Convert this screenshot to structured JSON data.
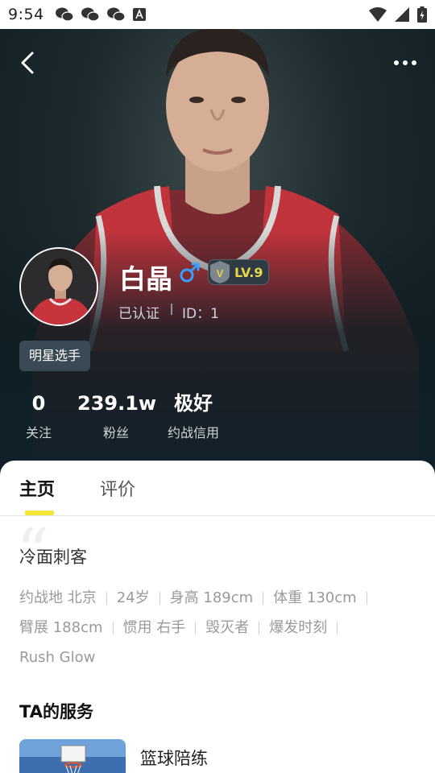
{
  "status_bar": {
    "time": "9:54",
    "left_icons": [
      "wechat-icon",
      "wechat-icon",
      "wechat-icon",
      "a-icon"
    ],
    "right_icons": [
      "wifi-icon",
      "signal-icon",
      "battery-icon"
    ]
  },
  "header": {
    "back_icon": "chevron-left-icon",
    "more_icon": "more-dots-icon"
  },
  "profile": {
    "name": "白晶",
    "gender_icon": "male-icon",
    "level": "LV.9",
    "level_shield_letter": "V",
    "verified": "已认证",
    "id": "ID：1",
    "tag": "明星选手"
  },
  "stats": [
    {
      "value": "0",
      "label": "关注"
    },
    {
      "value": "239.1w",
      "label": "粉丝"
    },
    {
      "value": "极好",
      "label": "约战信用"
    }
  ],
  "tabs": [
    {
      "label": "主页",
      "active": true
    },
    {
      "label": "评价",
      "active": false
    }
  ],
  "quote_mark": "“",
  "nickname": "冷面刺客",
  "attributes": [
    "约战地 北京",
    "24岁",
    "身高 189cm",
    "体重 130cm",
    "臂展 188cm",
    "惯用 右手",
    "毁灭者",
    "爆发时刻",
    "Rush Glow"
  ],
  "services": {
    "title": "TA的服务",
    "items": [
      {
        "name": "篮球陪练"
      }
    ]
  },
  "colors": {
    "accent_yellow": "#f2e63a",
    "level_text": "#e8d54a",
    "gender_blue": "#3aa0ff",
    "hero_bg": "#10212a"
  }
}
